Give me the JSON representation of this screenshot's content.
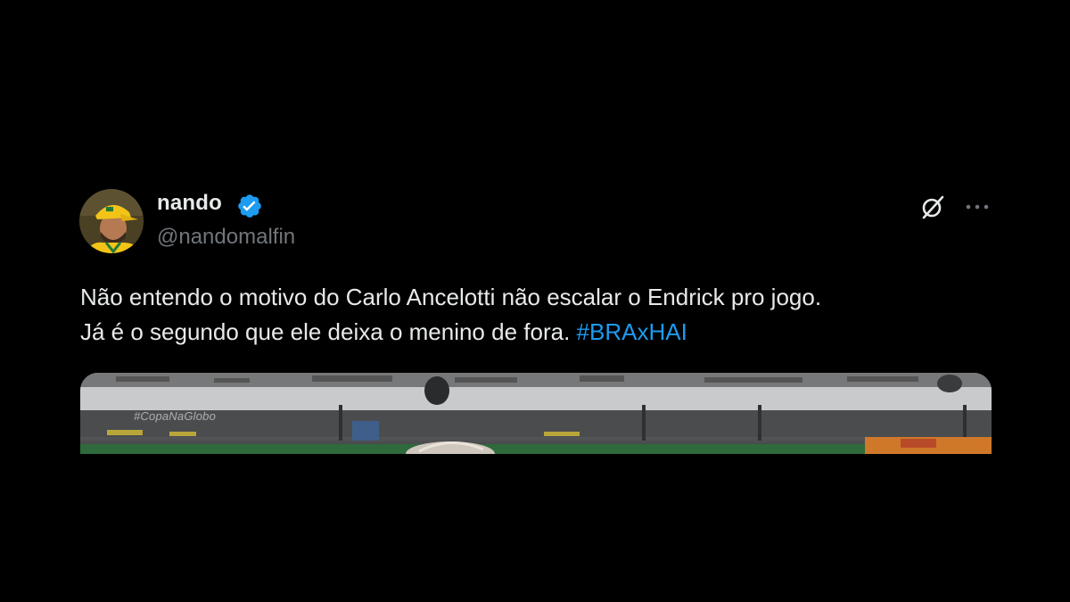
{
  "tweet": {
    "author": {
      "display_name": "nando",
      "handle": "@nandomalfin",
      "verified": true,
      "avatar_icon": "avatar-photo"
    },
    "text_lines": [
      "Não entendo o motivo do Carlo Ancelotti não escalar o Endrick pro jogo.",
      "Já é o segundo que ele deixa o menino de fora."
    ],
    "hashtag": "#BRAxHAI",
    "media": {
      "watermark": "#CopaNaGlobo"
    },
    "actions": {
      "grok_icon": "grok-icon",
      "more_icon": "more-icon"
    }
  },
  "colors": {
    "background": "#000000",
    "text": "#e7e9ea",
    "secondary_text": "#71767b",
    "link": "#1d9bf0",
    "verified_badge": "#1d9bf0"
  }
}
